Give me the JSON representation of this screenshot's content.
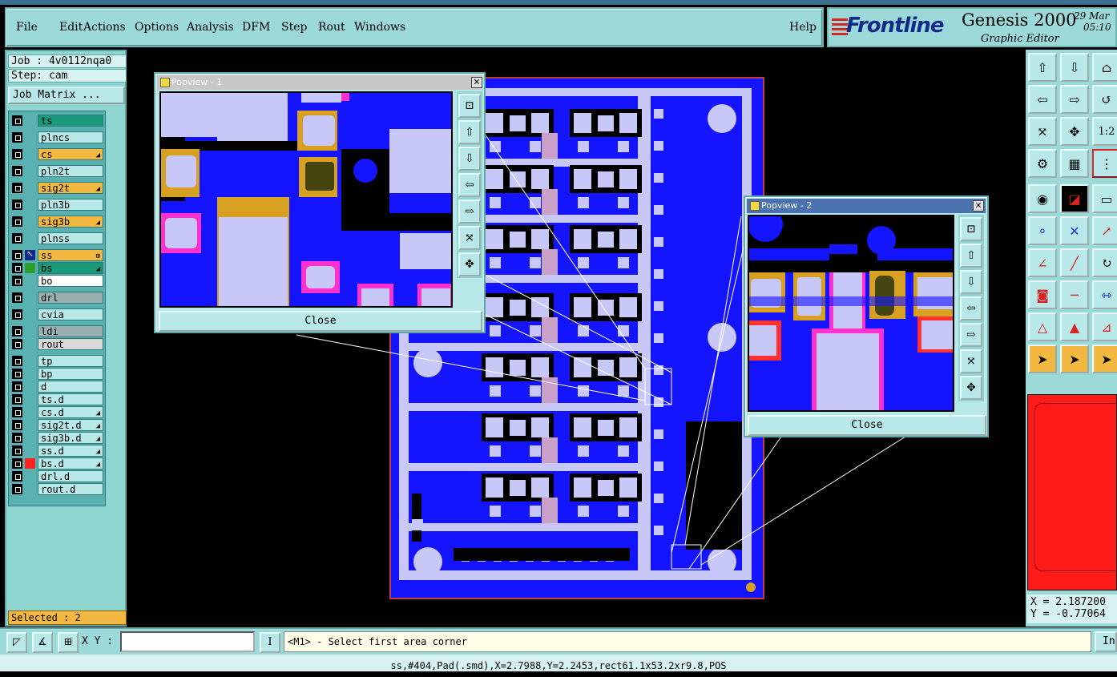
{
  "menu": {
    "items": [
      "File",
      "Edit",
      "Actions",
      "Options",
      "Analysis",
      "DFM",
      "Step",
      "Rout",
      "Windows"
    ],
    "help": "Help"
  },
  "brand": {
    "logo": "Frontline",
    "product": "Genesis 2000",
    "subtitle": "Graphic Editor",
    "date": "29 Mar",
    "time": "05:10"
  },
  "job": {
    "job_line": "Job : 4v0112nqa0",
    "step_line": "Step: cam",
    "matrix_label": "Job Matrix ..."
  },
  "layers": [
    {
      "name": "ts",
      "color": "#1a9a7a",
      "arrow": ""
    },
    {
      "name": "plncs",
      "color": "#b8e8e8",
      "arrow": ""
    },
    {
      "name": "cs",
      "color": "#f2b840",
      "arrow": "◢"
    },
    {
      "name": "pln2t",
      "color": "#b8e8e8",
      "arrow": ""
    },
    {
      "name": "sig2t",
      "color": "#f2b840",
      "arrow": "◢"
    },
    {
      "name": "pln3b",
      "color": "#b8e8e8",
      "arrow": ""
    },
    {
      "name": "sig3b",
      "color": "#f2b840",
      "arrow": "◢"
    },
    {
      "name": "plnss",
      "color": "#b8e8e8",
      "arrow": ""
    },
    {
      "name": "ss",
      "color": "#f2b840",
      "arrow": "⊞"
    },
    {
      "name": "bs",
      "color": "#1a9a7a",
      "arrow": "◢"
    },
    {
      "name": "bo",
      "color": "#ffffff",
      "arrow": ""
    },
    {
      "name": "drl",
      "color": "#9ab0b0",
      "arrow": ""
    },
    {
      "name": "cvia",
      "color": "#b8e8e8",
      "arrow": ""
    },
    {
      "name": "ldi",
      "color": "#9ab0b0",
      "arrow": ""
    },
    {
      "name": "rout",
      "color": "#d8d8d8",
      "arrow": ""
    },
    {
      "name": "tp",
      "color": "#b8e8e8",
      "arrow": ""
    },
    {
      "name": "bp",
      "color": "#b8e8e8",
      "arrow": ""
    },
    {
      "name": "d",
      "color": "#b8e8e8",
      "arrow": ""
    },
    {
      "name": "ts.d",
      "color": "#b8e8e8",
      "arrow": ""
    },
    {
      "name": "cs.d",
      "color": "#b8e8e8",
      "arrow": "◢"
    },
    {
      "name": "sig2t.d",
      "color": "#b8e8e8",
      "arrow": "◢"
    },
    {
      "name": "sig3b.d",
      "color": "#b8e8e8",
      "arrow": "◢"
    },
    {
      "name": "ss.d",
      "color": "#b8e8e8",
      "arrow": "◢"
    },
    {
      "name": "bs.d",
      "color": "#b8e8e8",
      "arrow": "◢"
    },
    {
      "name": "drl.d",
      "color": "#b8e8e8",
      "arrow": ""
    },
    {
      "name": "rout.d",
      "color": "#b8e8e8",
      "arrow": ""
    }
  ],
  "selected_text": "Selected : 2",
  "popup1": {
    "title": "Popview - 1",
    "close": "Close"
  },
  "popup2": {
    "title": "Popview - 2",
    "close": "Close"
  },
  "coords": {
    "x": "X =  2.187200",
    "y": "Y = -0.77064"
  },
  "bottom": {
    "xy_label": "X Y :",
    "xy_value": "",
    "prompt": "<M1> - Select first area corner",
    "right_btn": "In"
  },
  "status": "ss,#404,Pad(.smd),X=2.7988,Y=2.2453,rect61.1x53.2xr9.8,POS",
  "colors": {
    "accent": "#9cdada",
    "board": "#1414ff",
    "pad": "#c8c8f8",
    "highlight": "#f2b840"
  }
}
